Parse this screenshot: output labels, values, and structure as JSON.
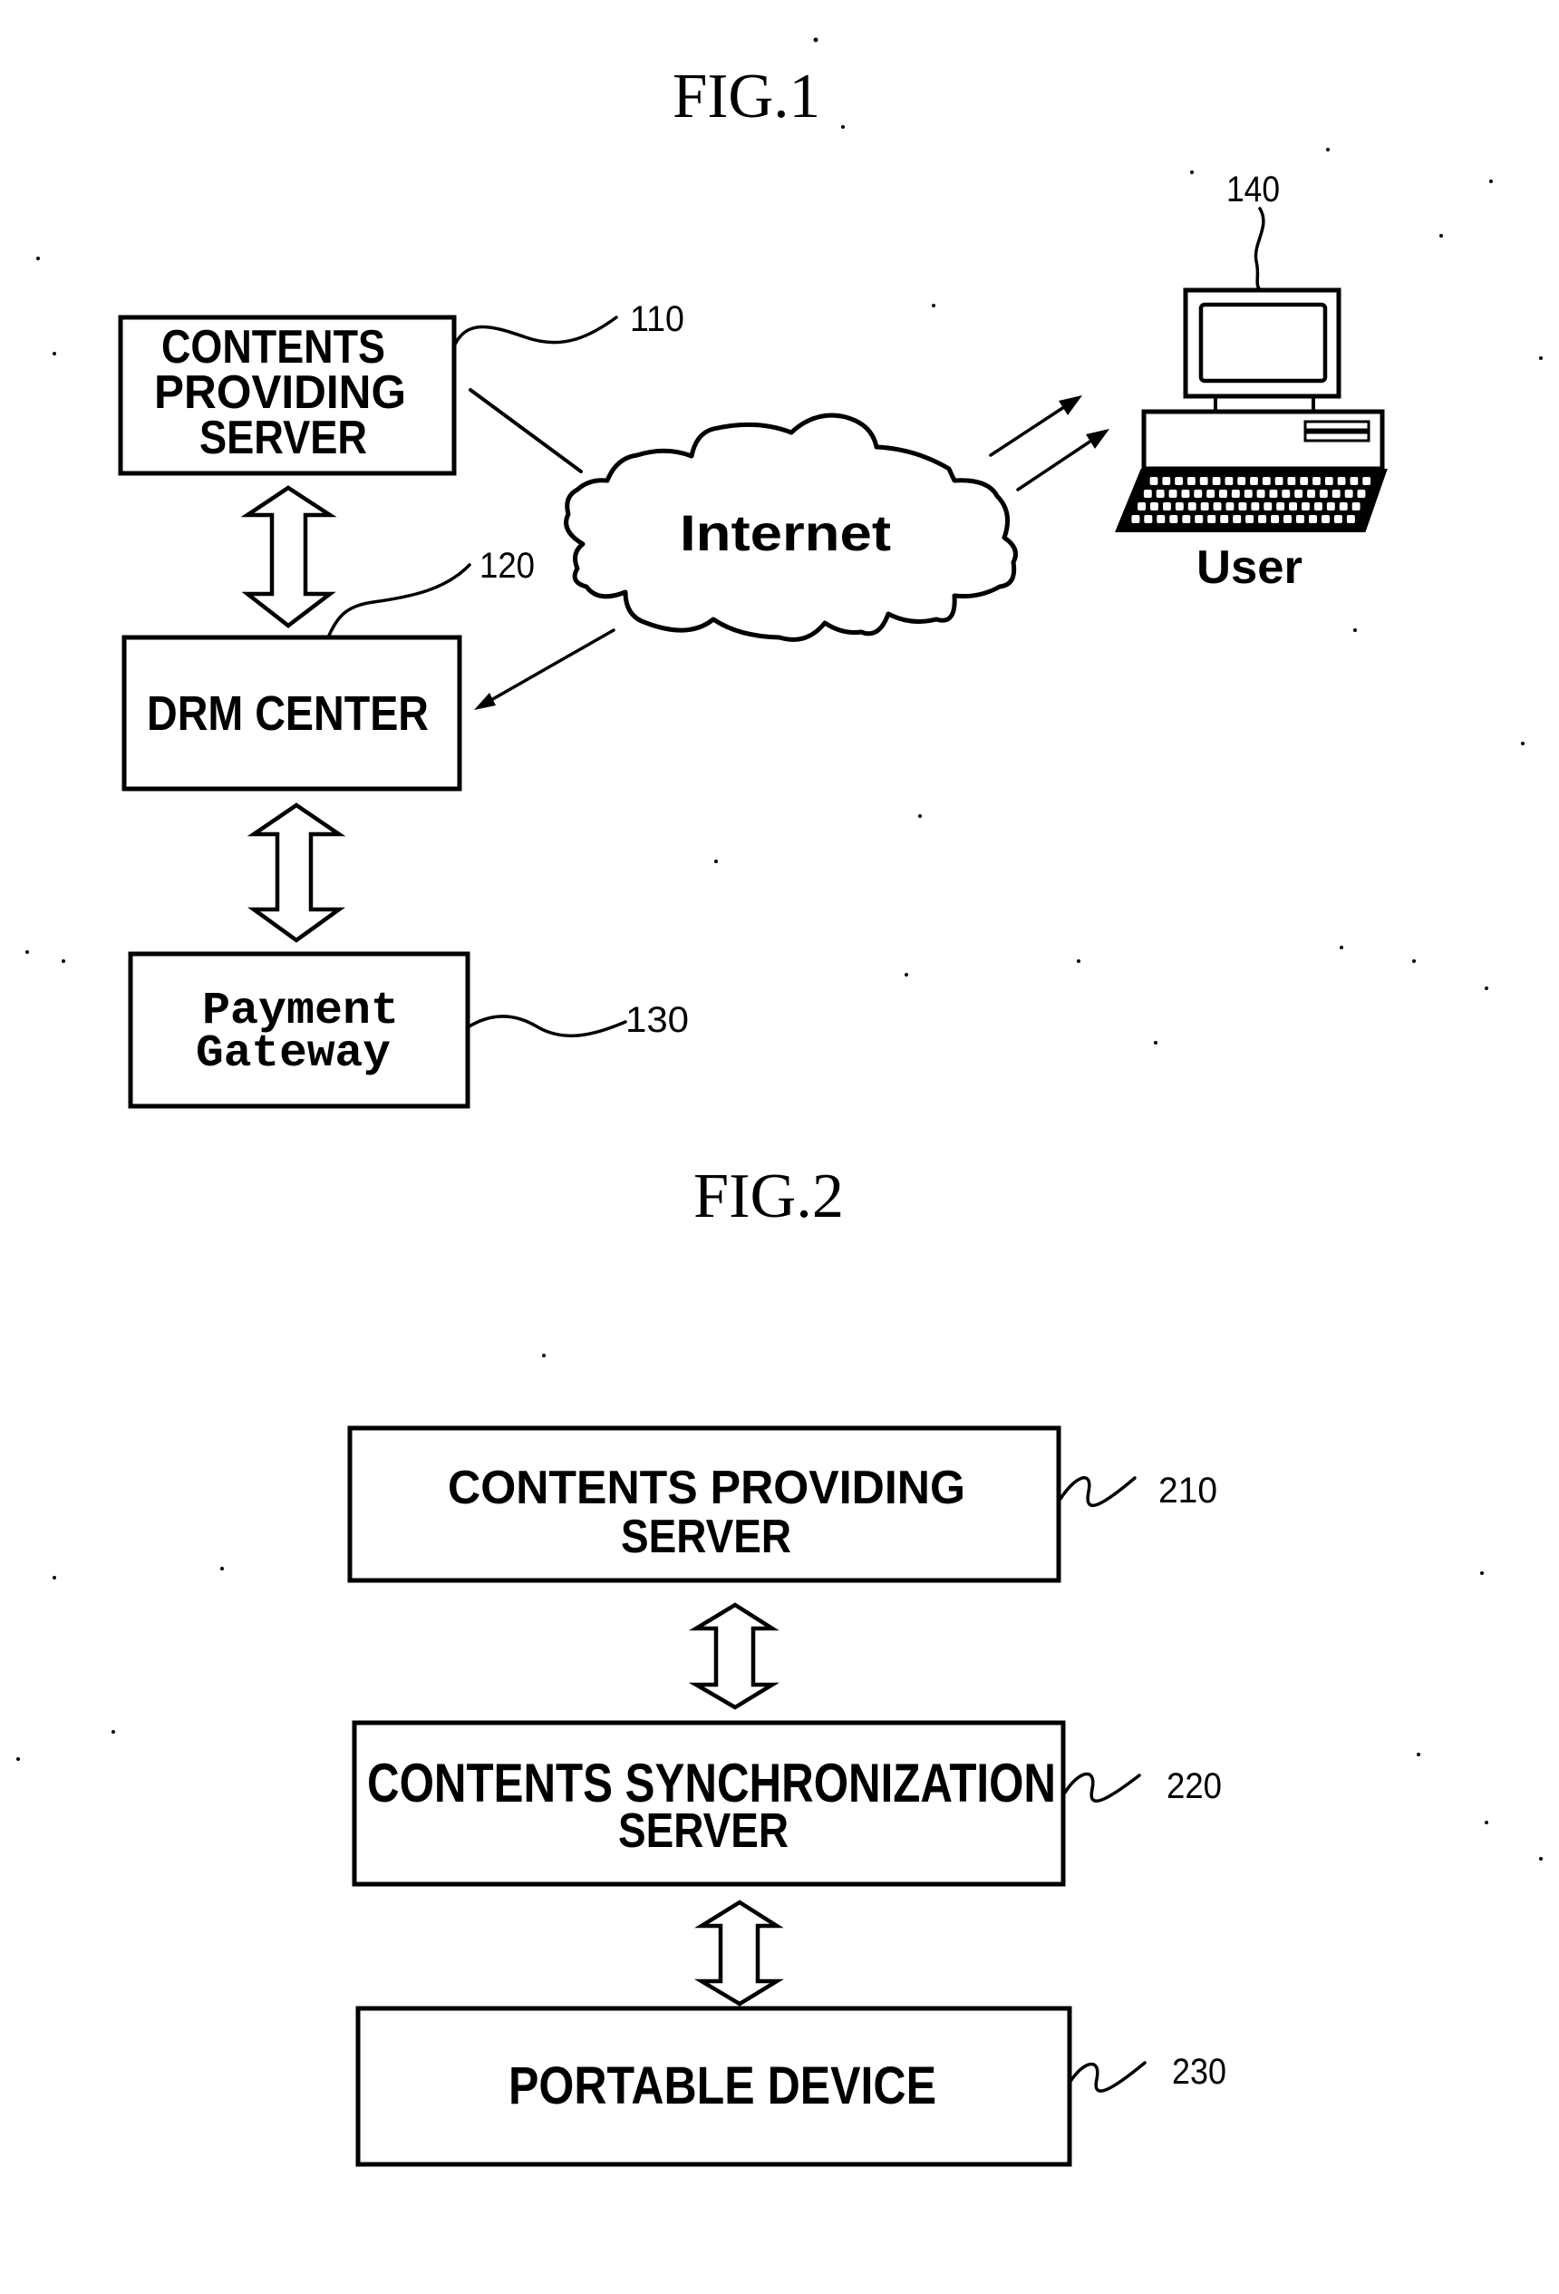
{
  "fig1": {
    "title": "FIG.1",
    "contents_server": {
      "lines": [
        "CONTENTS",
        "PROVIDING",
        "SERVER"
      ],
      "ref": "110"
    },
    "drm_center": {
      "label": "DRM CENTER",
      "ref": "120"
    },
    "payment_gateway": {
      "lines": [
        "Payment",
        "Gateway"
      ],
      "ref": "130"
    },
    "internet": {
      "label": "Internet",
      "icon": "cloud-icon"
    },
    "user": {
      "label": "User",
      "ref": "140",
      "icon": "desktop-computer-icon"
    }
  },
  "fig2": {
    "title": "FIG.2",
    "contents_server": {
      "lines": [
        "CONTENTS PROVIDING",
        "SERVER"
      ],
      "ref": "210"
    },
    "sync_server": {
      "lines": [
        "CONTENTS SYNCHRONIZATION",
        "SERVER"
      ],
      "ref": "220"
    },
    "portable_device": {
      "label": "PORTABLE DEVICE",
      "ref": "230"
    }
  },
  "icons": {
    "bidirectional": "double-arrow-icon",
    "cloud": "cloud-icon",
    "computer": "desktop-computer-icon"
  },
  "colors": {
    "ink": "#000000",
    "paper": "#ffffff"
  }
}
